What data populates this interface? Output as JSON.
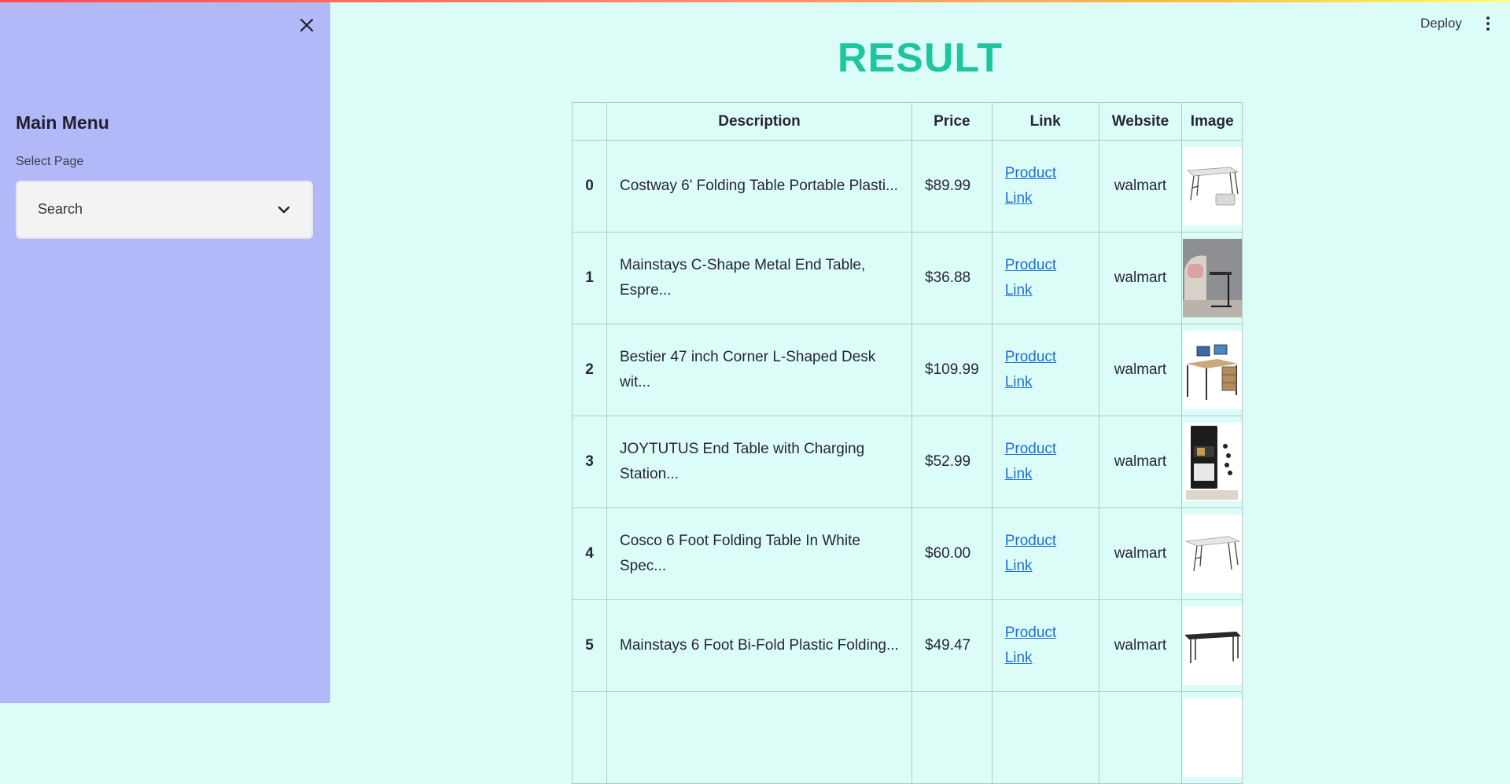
{
  "sidebar": {
    "menu_title": "Main Menu",
    "select_label": "Select Page",
    "select_value": "Search"
  },
  "header": {
    "deploy_label": "Deploy"
  },
  "main": {
    "title": "RESULT",
    "columns": [
      "",
      "Description",
      "Price",
      "Link",
      "Website",
      "Image"
    ],
    "rows": [
      {
        "index": "0",
        "description": "Costway 6' Folding Table Portable Plasti...",
        "price": "$89.99",
        "link": "Product Link",
        "website": "walmart",
        "image": "folding-table"
      },
      {
        "index": "1",
        "description": "Mainstays C-Shape Metal End Table, Espre...",
        "price": "$36.88",
        "link": "Product Link",
        "website": "walmart",
        "image": "c-shape-end-table"
      },
      {
        "index": "2",
        "description": "Bestier 47 inch Corner L-Shaped Desk wit...",
        "price": "$109.99",
        "link": "Product Link",
        "website": "walmart",
        "image": "l-shaped-desk"
      },
      {
        "index": "3",
        "description": "JOYTUTUS End Table with Charging Station...",
        "price": "$52.99",
        "link": "Product Link",
        "website": "walmart",
        "image": "charging-end-table"
      },
      {
        "index": "4",
        "description": "Cosco 6 Foot Folding Table In White Spec...",
        "price": "$60.00",
        "link": "Product Link",
        "website": "walmart",
        "image": "white-folding-table"
      },
      {
        "index": "5",
        "description": "Mainstays 6 Foot Bi-Fold Plastic Folding...",
        "price": "$49.47",
        "link": "Product Link",
        "website": "walmart",
        "image": "black-folding-table"
      },
      {
        "index": "",
        "description": "",
        "price": "",
        "link": "",
        "website": "",
        "image": ""
      }
    ]
  },
  "colors": {
    "sidebar_bg": "#b3b8f8",
    "main_bg": "#dcfdf7",
    "title": "#1ec6a0",
    "link": "#1f6fd1"
  }
}
